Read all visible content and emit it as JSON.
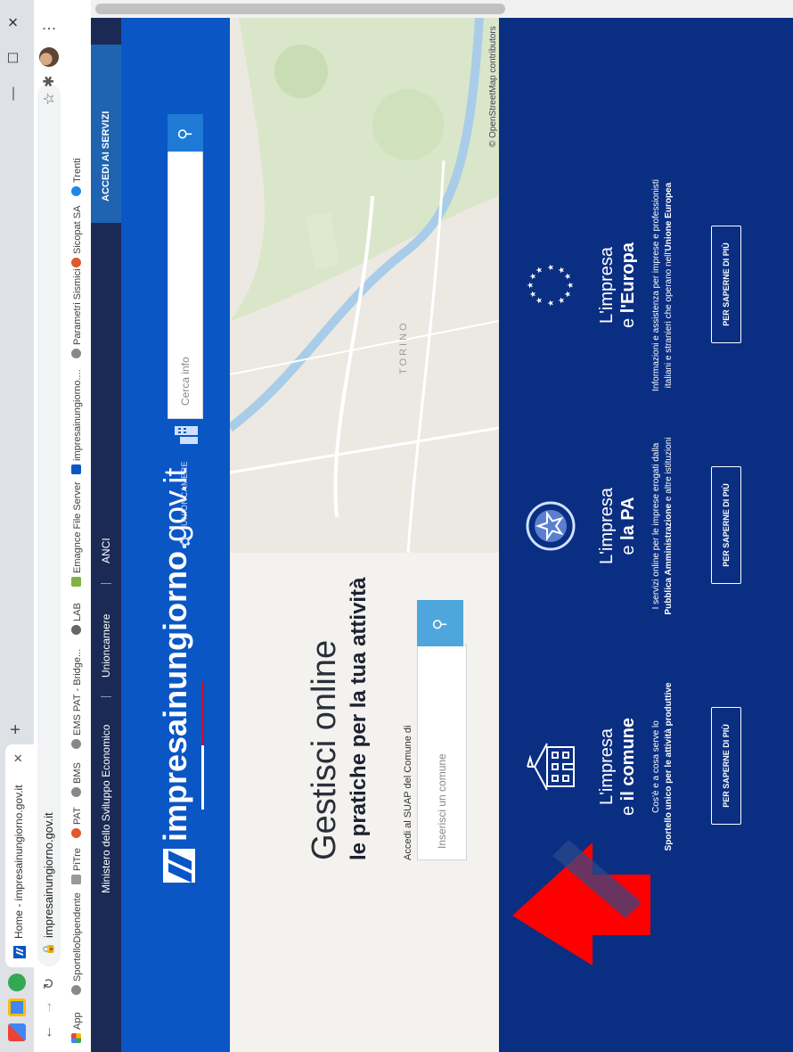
{
  "browser": {
    "tab_title": "Home - impresainungiorno.gov.it",
    "url": "impresainungiorno.gov.it",
    "bookmarks": [
      "App",
      "SportelloDipendente",
      "PiTre",
      "PAT",
      "BMS",
      "EMS PAT - Bridge...",
      "LAB",
      "Emagnce File Server",
      "impresainungiorno....",
      "Parametri Sismici",
      "Sicopat SA",
      "Trenti"
    ]
  },
  "topnav": {
    "items": [
      "Ministero dello Sviluppo Economico",
      "Unioncamere",
      "ANCI"
    ],
    "accedi": "ACCEDI AI SERVIZI"
  },
  "header": {
    "logo_bold": "impresainungiorno",
    "logo_rest": ".gov.it",
    "unioncamere": "UNIONCAMERE",
    "search_placeholder": "Cerca info"
  },
  "hero": {
    "title1": "Gestisci online",
    "title2": "le pratiche per la tua attività",
    "suap_label": "Accedi al SUAP del Comune di",
    "search_placeholder": "Inserisci un comune",
    "map_labels": [
      "TORINO"
    ],
    "osm_credit": "© OpenStreetMap contributors"
  },
  "cards": [
    {
      "line1": "L'impresa",
      "line2_pre": "e ",
      "line2_bold": "il comune",
      "desc": "Cos'è e a cosa serve lo",
      "desc_bold": "Sportello unico per le attività produttive",
      "desc_rest": "",
      "button": "PER SAPERNE DI PIÙ"
    },
    {
      "line1": "L'impresa",
      "line2_pre": "e ",
      "line2_bold": "la PA",
      "desc": "I servizi online per le imprese erogati dalla",
      "desc_bold": "Pubblica Amministrazione",
      "desc_rest": " e altre istituzioni",
      "button": "PER SAPERNE DI PIÙ"
    },
    {
      "line1": "L'impresa",
      "line2_pre": "e ",
      "line2_bold": "l'Europa",
      "desc": "Informazioni e assistenza per imprese e professionisti italiani e stranieri che operano nell'",
      "desc_bold": "Unione Europea",
      "desc_rest": "",
      "button": "PER SAPERNE DI PIÙ"
    }
  ],
  "colors": {
    "brand_blue": "#0a56c4",
    "nav_dark": "#1b2a55",
    "cards_bg": "#0a2e82",
    "search_btn": "#4ea6dd",
    "arrow_red": "#ff0000"
  }
}
